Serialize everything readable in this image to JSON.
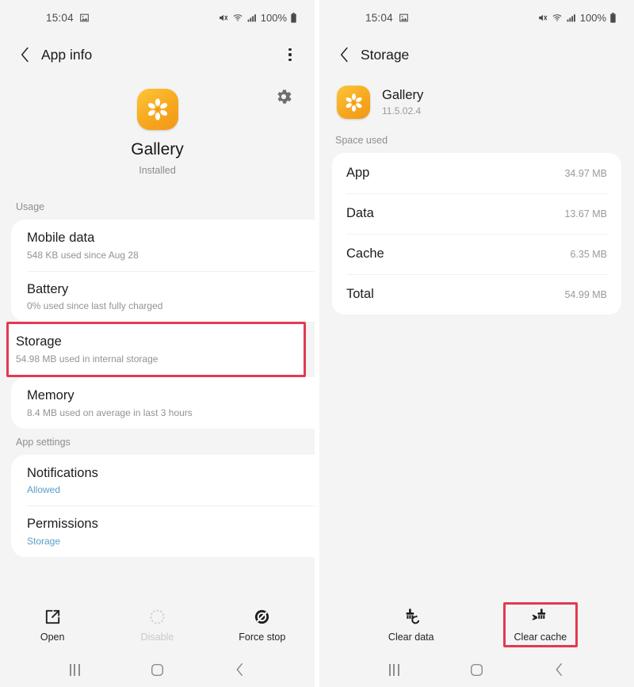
{
  "left": {
    "statusbar": {
      "time": "15:04",
      "battery_percent": "100%",
      "icons": [
        "image-icon",
        "volume-mute-icon",
        "wifi-icon",
        "signal-icon",
        "battery-icon"
      ]
    },
    "appbar": {
      "title": "App info",
      "back": "back-icon",
      "menu": "more-options-icon"
    },
    "hero": {
      "settings_icon": "gear-icon",
      "app_name": "Gallery",
      "status": "Installed"
    },
    "sections": [
      {
        "label": "Usage",
        "rows": [
          {
            "title": "Mobile data",
            "sub": "548 KB used since Aug 28",
            "highlighted": false,
            "link": false
          },
          {
            "title": "Battery",
            "sub": "0% used since last fully charged",
            "highlighted": false,
            "link": false
          },
          {
            "title": "Storage",
            "sub": "54.98 MB used in internal storage",
            "highlighted": true,
            "link": false
          },
          {
            "title": "Memory",
            "sub": "8.4 MB used on average in last 3 hours",
            "highlighted": false,
            "link": false
          }
        ]
      },
      {
        "label": "App settings",
        "rows": [
          {
            "title": "Notifications",
            "sub": "Allowed",
            "highlighted": false,
            "link": true
          },
          {
            "title": "Permissions",
            "sub": "Storage",
            "highlighted": false,
            "link": true
          }
        ]
      }
    ],
    "actions": [
      {
        "label": "Open",
        "icon": "open-external-icon",
        "disabled": false,
        "boxed": false
      },
      {
        "label": "Disable",
        "icon": "disable-icon",
        "disabled": true,
        "boxed": false
      },
      {
        "label": "Force stop",
        "icon": "force-stop-icon",
        "disabled": false,
        "boxed": false
      }
    ]
  },
  "right": {
    "statusbar": {
      "time": "15:04",
      "battery_percent": "100%",
      "icons": [
        "image-icon",
        "volume-mute-icon",
        "wifi-icon",
        "signal-icon",
        "battery-icon"
      ]
    },
    "appbar": {
      "title": "Storage",
      "back": "back-icon"
    },
    "app_strip": {
      "name": "Gallery",
      "version": "11.5.02.4"
    },
    "space_label": "Space used",
    "storage_rows": [
      {
        "key": "App",
        "value": "34.97 MB"
      },
      {
        "key": "Data",
        "value": "13.67 MB"
      },
      {
        "key": "Cache",
        "value": "6.35 MB"
      },
      {
        "key": "Total",
        "value": "54.99 MB"
      }
    ],
    "actions": [
      {
        "label": "Clear data",
        "icon": "clear-data-icon",
        "disabled": false,
        "boxed": false
      },
      {
        "label": "Clear cache",
        "icon": "clear-cache-icon",
        "disabled": false,
        "boxed": true
      }
    ]
  },
  "navbar": {
    "recents": "recents-icon",
    "home": "home-icon",
    "back": "back-nav-icon"
  },
  "colors": {
    "accent_orange": "#f7a81e",
    "highlight_red": "#e23a52",
    "link_blue": "#5a9ec9"
  }
}
